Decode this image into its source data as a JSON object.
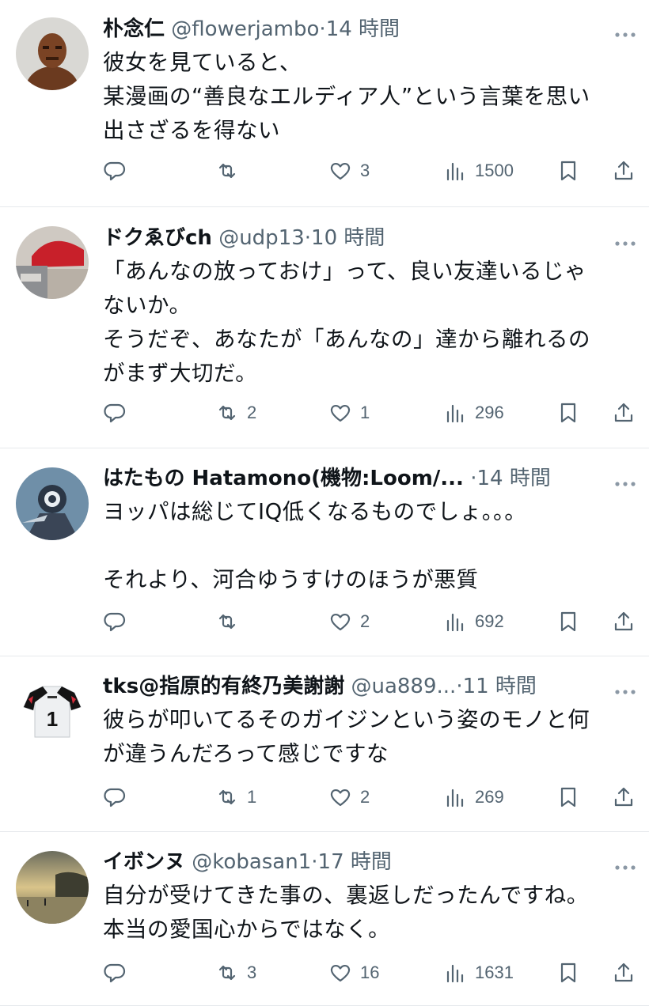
{
  "posts": [
    {
      "name": "朴念仁",
      "handle": "@flowerjambo",
      "sep": "·",
      "time": "14 時間",
      "lines": [
        "彼女を見ていると、",
        "某漫画の“善良なエルディア人”という言葉を思い",
        "出さざるを得ない"
      ],
      "replies": "",
      "reposts": "",
      "likes": "3",
      "views": "1500",
      "avatar": "stone-giant-figure"
    },
    {
      "name": "ドクゑびch",
      "handle": "@udp13",
      "sep": "·",
      "time": "10 時間",
      "lines": [
        "「あんなの放っておけ」って、良い友達いるじゃ",
        "ないか。",
        "そうだぞ、あなたが「あんなの」達から離れるの",
        "がまず大切だ。"
      ],
      "replies": "",
      "reposts": "2",
      "likes": "1",
      "views": "296",
      "avatar": "red-cap-person"
    },
    {
      "name": "はたもの Hatamono(機物:Loom/...",
      "handle": "",
      "sep": "·",
      "time": "14 時間",
      "lines": [
        "ヨッパは総じてIQ低くなるものでしょ。。。",
        "",
        "それより、河合ゆうすけのほうが悪質"
      ],
      "replies": "",
      "reposts": "",
      "likes": "2",
      "views": "692",
      "avatar": "armored-knight"
    },
    {
      "name": "tks@指原的有終乃美謝謝",
      "handle": "@ua889...",
      "sep": "·",
      "time": "11 時間",
      "lines": [
        "彼らが叩いてるそのガイジンという姿のモノと何",
        "が違うんだろって感じですな"
      ],
      "replies": "",
      "reposts": "1",
      "likes": "2",
      "views": "269",
      "avatar": "jersey-number-1",
      "avatar_text": "1"
    },
    {
      "name": "イボンヌ",
      "handle": "@kobasan1",
      "sep": "·",
      "time": "17 時間",
      "lines": [
        "自分が受けてきた事の、裏返しだったんですね。",
        "本当の愛国心からではなく。"
      ],
      "replies": "",
      "reposts": "3",
      "likes": "16",
      "views": "1631",
      "avatar": "sunset-beach"
    }
  ],
  "icons": {
    "reply": "reply-icon",
    "repost": "repost-icon",
    "like": "heart-icon",
    "views": "analytics-icon",
    "bookmark": "bookmark-icon",
    "share": "share-icon",
    "more": "more-dots-icon"
  },
  "colors": {
    "text": "#0f1419",
    "muted": "#536471",
    "divider": "#e6e9ec",
    "background": "#ffffff"
  }
}
